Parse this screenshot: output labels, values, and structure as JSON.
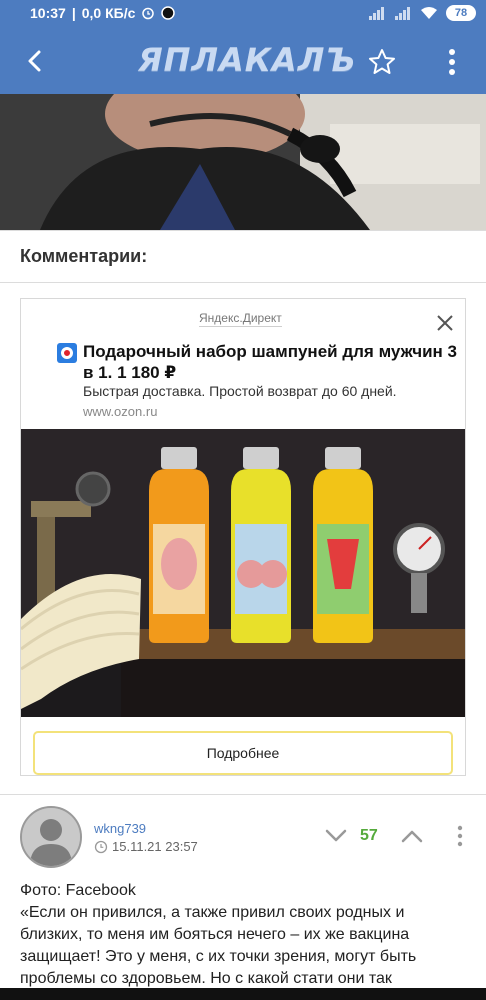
{
  "status_bar": {
    "time": "10:37",
    "network_speed": "0,0 КБ/с",
    "battery": "78"
  },
  "app_bar": {
    "logo_text": "ЯПЛАКАЛЪ",
    "colors": {
      "bar": "#4d7cc0",
      "logo": "#c9daf2"
    }
  },
  "section": {
    "comments_title": "Комментарии:"
  },
  "ad": {
    "source": "Яндекс.Директ",
    "title": "Подарочный набор шампуней для мужчин 3 в 1. 1 180 ₽",
    "description": "Быстрая доставка. Простой возврат до 60 дней.",
    "domain": "www.ozon.ru",
    "button_label": "Подробнее"
  },
  "comment": {
    "username": "wkng739",
    "timestamp": "15.11.21 23:57",
    "score": "57",
    "lines": [
      "Фото: Facebook",
      "«Если он привился, а также привил своих родных и близких, то меня им бояться нечего – их же вакцина защищает! Это у меня, с их точки зрения, могут быть проблемы со здоровьем. Но с какой стати они так"
    ],
    "colors": {
      "username": "#4d7cc0",
      "score": "#55aa3c"
    }
  }
}
